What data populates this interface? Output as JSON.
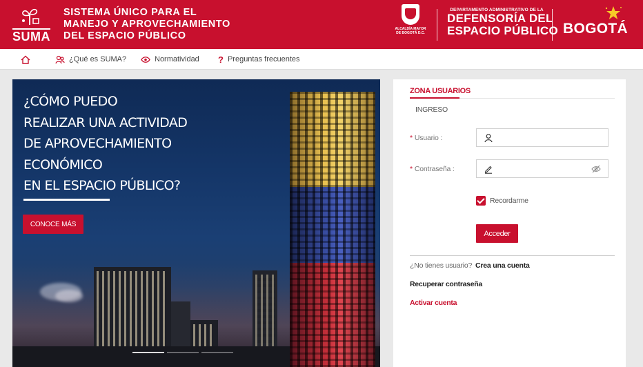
{
  "header": {
    "logo_text": "SUMA",
    "title_lines": [
      "SISTEMA ÚNICO PARA EL",
      "MANEJO Y APROVECHAMIENTO",
      "DEL ESPACIO PÚBLICO"
    ],
    "alcaldia_lines": [
      "ALCALDÍA MAYOR",
      "DE BOGOTÁ D.C."
    ],
    "dadep_small": "DEPARTAMENTO ADMINISTRATIVO DE LA",
    "dadep_lines": [
      "DEFENSORÍA DEL",
      "ESPACIO PÚBLICO"
    ],
    "city_logo": "BOGOTÁ",
    "brand_color": "#c8102e"
  },
  "nav": {
    "items": [
      {
        "icon": "home-icon",
        "label": ""
      },
      {
        "icon": "people-icon",
        "label": "¿Qué es SUMA?"
      },
      {
        "icon": "eye-icon",
        "label": "Normatividad"
      },
      {
        "icon": "question-icon",
        "label": "Preguntas frecuentes"
      }
    ]
  },
  "hero": {
    "lines": [
      "¿CÓMO PUEDO",
      "REALIZAR UNA ACTIVIDAD",
      "DE APROVECHAMIENTO",
      "ECONÓMICO",
      "EN EL ESPACIO PÚBLICO?"
    ],
    "button_label": "CONOCE MÁS"
  },
  "login": {
    "zone_title": "ZONA USUARIOS",
    "tab_label": "INGRESO",
    "user_label": "Usuario :",
    "user_value": "",
    "password_label": "Contraseña :",
    "password_value": "",
    "required_mark": "*",
    "remember_label": "Recordarme",
    "remember_checked": true,
    "submit_label": "Acceder",
    "no_user_text": "¿No tienes usuario?",
    "create_account": "Crea una cuenta",
    "recover_password": "Recuperar contraseña",
    "activate_account": "Activar cuenta"
  }
}
